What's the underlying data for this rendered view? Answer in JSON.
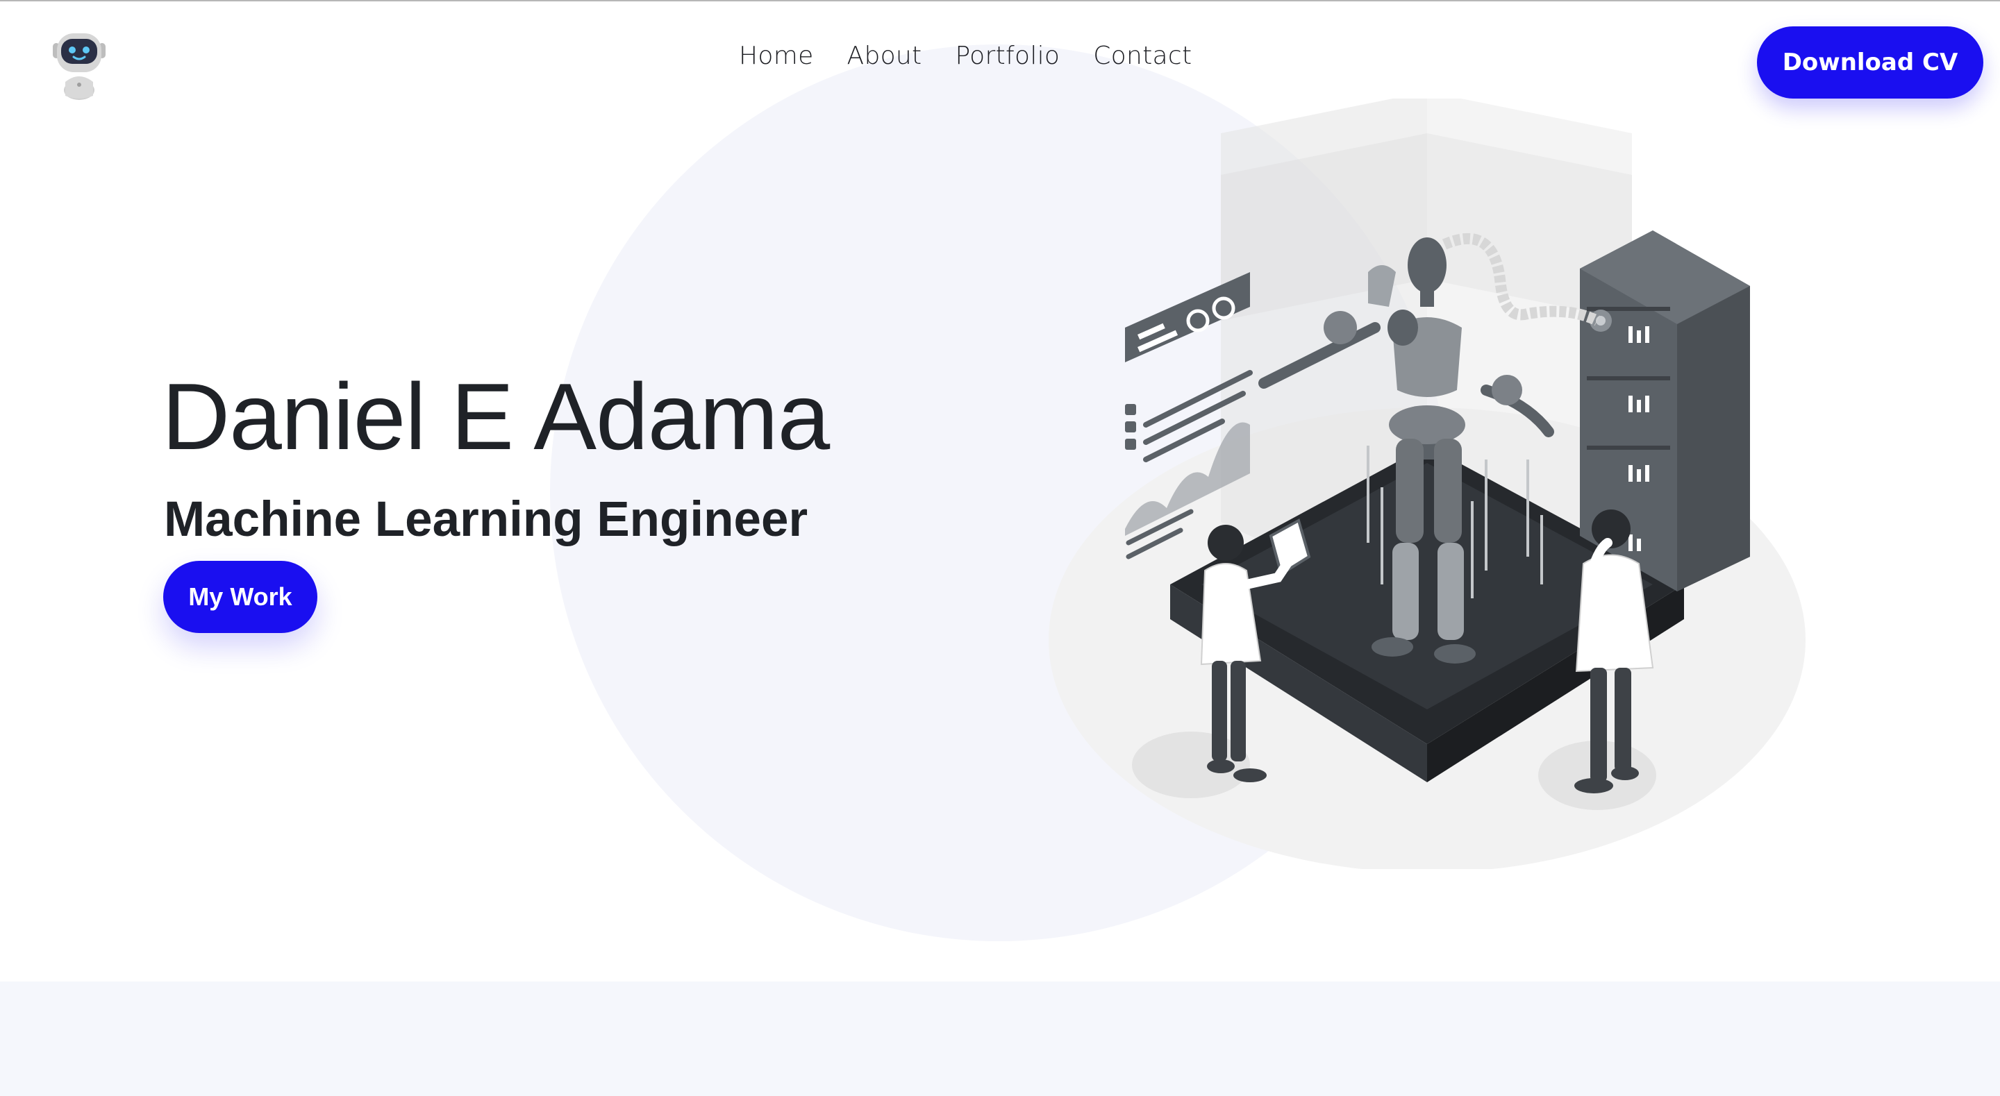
{
  "header": {
    "logo_icon": "robot-logo-icon",
    "nav": [
      {
        "label": "Home"
      },
      {
        "label": "About"
      },
      {
        "label": "Portfolio"
      },
      {
        "label": "Contact"
      }
    ],
    "cta_label": "Download CV"
  },
  "hero": {
    "name": "Daniel E Adama",
    "role": "Machine Learning Engineer",
    "button_label": "My Work",
    "illustration_icon": "robot-lab-illustration"
  },
  "colors": {
    "accent": "#1a0ff0",
    "text": "#1f2227",
    "soft_background": "#f4f5fb",
    "illustration_dark": "#5b6167"
  }
}
